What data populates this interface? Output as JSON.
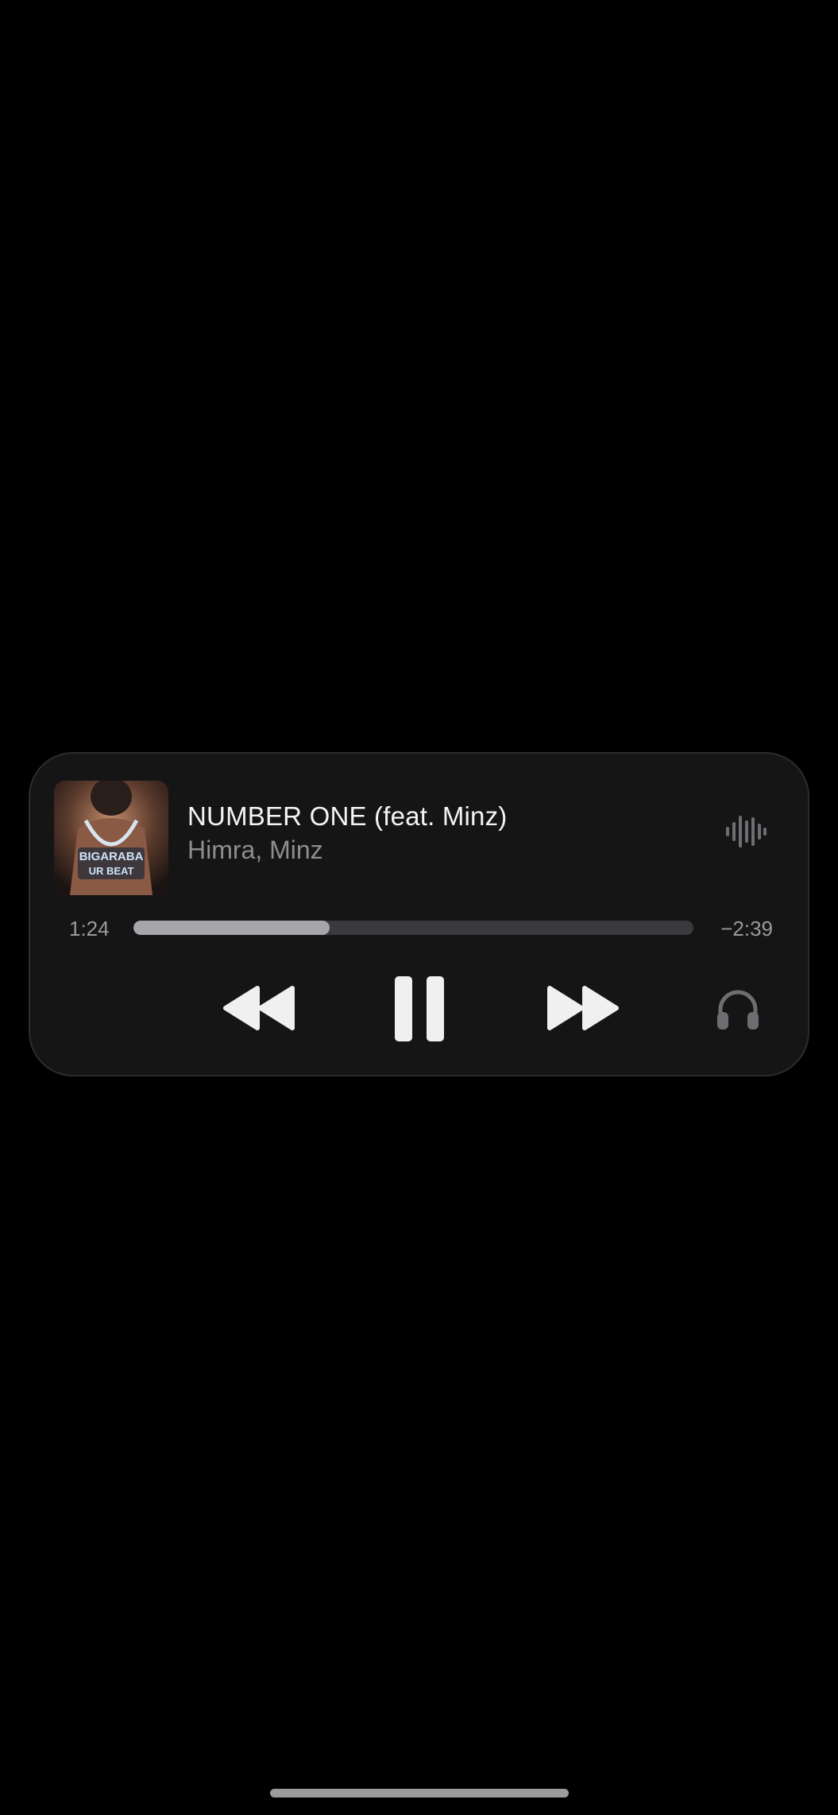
{
  "now_playing": {
    "title": "NUMBER ONE (feat. Minz)",
    "artist": "Himra, Minz",
    "elapsed": "1:24",
    "remaining": "−2:39",
    "progress_fraction": 0.35,
    "artwork_text": [
      "BIGARABA",
      "UR BEAT"
    ]
  },
  "controls": {
    "rewind_icon": "rewind-icon",
    "pause_icon": "pause-icon",
    "forward_icon": "fast-forward-icon",
    "audio_output_icon": "headphones-icon",
    "waveform_icon": "waveform-icon"
  },
  "colors": {
    "background": "#000000",
    "card": "#151515",
    "progress_fill": "#a6a6aa",
    "progress_track": "#3a3a3e",
    "secondary_text": "#8e8e92"
  }
}
